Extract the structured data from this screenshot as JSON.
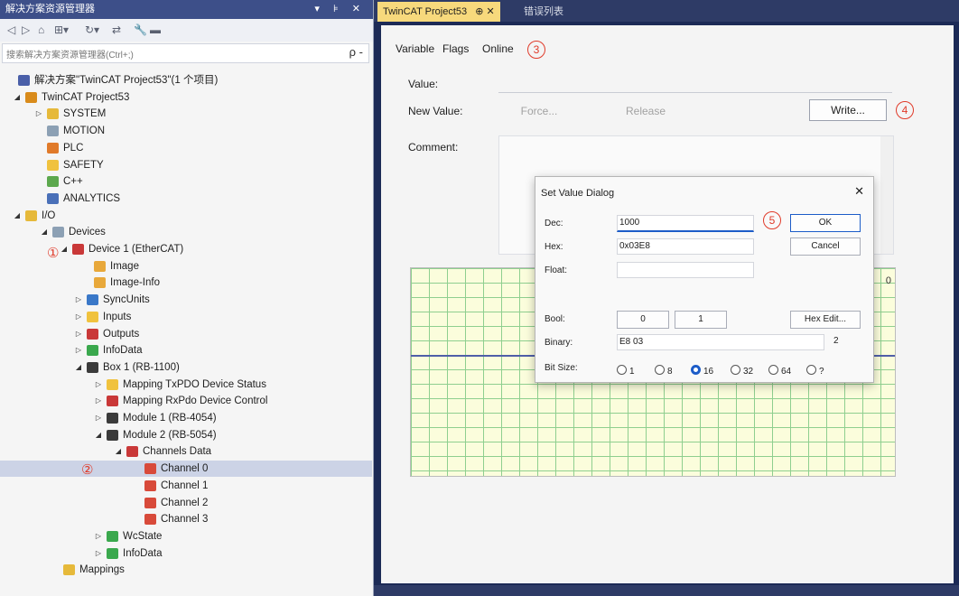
{
  "left_panel": {
    "title": "解决方案资源管理器",
    "title_controls": "▾ ⊧ ✕",
    "search_placeholder": "搜索解决方案资源管理器(Ctrl+;)",
    "search_icon": "ρ -"
  },
  "tree": [
    {
      "label": "解决方案\"TwinCAT Project53\"(1 个项目)",
      "icon": "solution-icon",
      "color": "#4a5fa8"
    },
    {
      "label": "TwinCAT Project53",
      "icon": "project-icon",
      "color": "#d98b1b"
    },
    {
      "label": "SYSTEM",
      "icon": "system-icon",
      "color": "#e6b93a"
    },
    {
      "label": "MOTION",
      "icon": "motion-icon",
      "color": "#8ca0b4"
    },
    {
      "label": "PLC",
      "icon": "plc-icon",
      "color": "#e07a2a"
    },
    {
      "label": "SAFETY",
      "icon": "safety-icon",
      "color": "#f0c23e"
    },
    {
      "label": "C++",
      "icon": "cpp-icon",
      "color": "#5ca84d"
    },
    {
      "label": "ANALYTICS",
      "icon": "analytics-icon",
      "color": "#4a70b8"
    },
    {
      "label": "I/O",
      "icon": "io-icon",
      "color": "#e6b93a"
    },
    {
      "label": "Devices",
      "icon": "devices-icon",
      "color": "#8ca0b4"
    },
    {
      "label": "Device 1 (EtherCAT)",
      "icon": "ethercat-icon",
      "color": "#c93838"
    },
    {
      "label": "Image",
      "icon": "image-icon",
      "color": "#e8a83a"
    },
    {
      "label": "Image-Info",
      "icon": "image-info-icon",
      "color": "#e8a83a"
    },
    {
      "label": "SyncUnits",
      "icon": "syncunits-icon",
      "color": "#3a78c8"
    },
    {
      "label": "Inputs",
      "icon": "inputs-icon",
      "color": "#f0c23e"
    },
    {
      "label": "Outputs",
      "icon": "outputs-icon",
      "color": "#c93838"
    },
    {
      "label": "InfoData",
      "icon": "infodata-icon",
      "color": "#3aa84d"
    },
    {
      "label": "Box 1 (RB-1100)",
      "icon": "box-icon",
      "color": "#3b3b3b"
    },
    {
      "label": "Mapping TxPDO Device Status",
      "icon": "mapping-tx-icon",
      "color": "#f0c23e"
    },
    {
      "label": "Mapping RxPdo Device Control",
      "icon": "mapping-rx-icon",
      "color": "#c93838"
    },
    {
      "label": "Module 1 (RB-4054)",
      "icon": "module-icon",
      "color": "#3b3b3b"
    },
    {
      "label": "Module 2 (RB-5054)",
      "icon": "module-icon",
      "color": "#3b3b3b"
    },
    {
      "label": "Channels Data",
      "icon": "channels-icon",
      "color": "#c93838"
    },
    {
      "label": "Channel 0",
      "icon": "channel-icon",
      "color": "#d84a3a"
    },
    {
      "label": "Channel 1",
      "icon": "channel-icon",
      "color": "#d84a3a"
    },
    {
      "label": "Channel 2",
      "icon": "channel-icon",
      "color": "#d84a3a"
    },
    {
      "label": "Channel 3",
      "icon": "channel-icon",
      "color": "#d84a3a"
    },
    {
      "label": "WcState",
      "icon": "wcstate-icon",
      "color": "#3aa84d"
    },
    {
      "label": "InfoData",
      "icon": "infodata-icon",
      "color": "#3aa84d"
    },
    {
      "label": "Mappings",
      "icon": "mappings-icon",
      "color": "#e6b93a"
    }
  ],
  "markers": {
    "one": "①",
    "two": "②"
  },
  "tabs": {
    "active": "TwinCAT Project53",
    "active_suffix": "⊕ ✕",
    "errors": "错误列表"
  },
  "subtabs": {
    "variable": "Variable",
    "flags": "Flags",
    "online": "Online"
  },
  "online": {
    "value_label": "Value:",
    "new_value_label": "New Value:",
    "force_button": "Force...",
    "release_button": "Release",
    "write_button": "Write...",
    "comment_label": "Comment:",
    "graph_zero": "0"
  },
  "step_markers": {
    "three": "3",
    "four": "4",
    "five": "5"
  },
  "dialog": {
    "title": "Set Value Dialog",
    "close": "✕",
    "dec_label": "Dec:",
    "dec_value": "1000",
    "hex_label": "Hex:",
    "hex_value": "0x03E8",
    "float_label": "Float:",
    "float_value": "",
    "bool_label": "Bool:",
    "bool_value_1": "0",
    "bool_value_2": "1",
    "binary_label": "Binary:",
    "binary_value": "E8 03",
    "binary_count": "2",
    "bitsize_label": "Bit Size:",
    "ok_button": "OK",
    "cancel_button": "Cancel",
    "hex_edit_button": "Hex Edit...",
    "bit_sizes": [
      "1",
      "8",
      "16",
      "32",
      "64",
      "?"
    ],
    "selected_bit_size": "16"
  }
}
